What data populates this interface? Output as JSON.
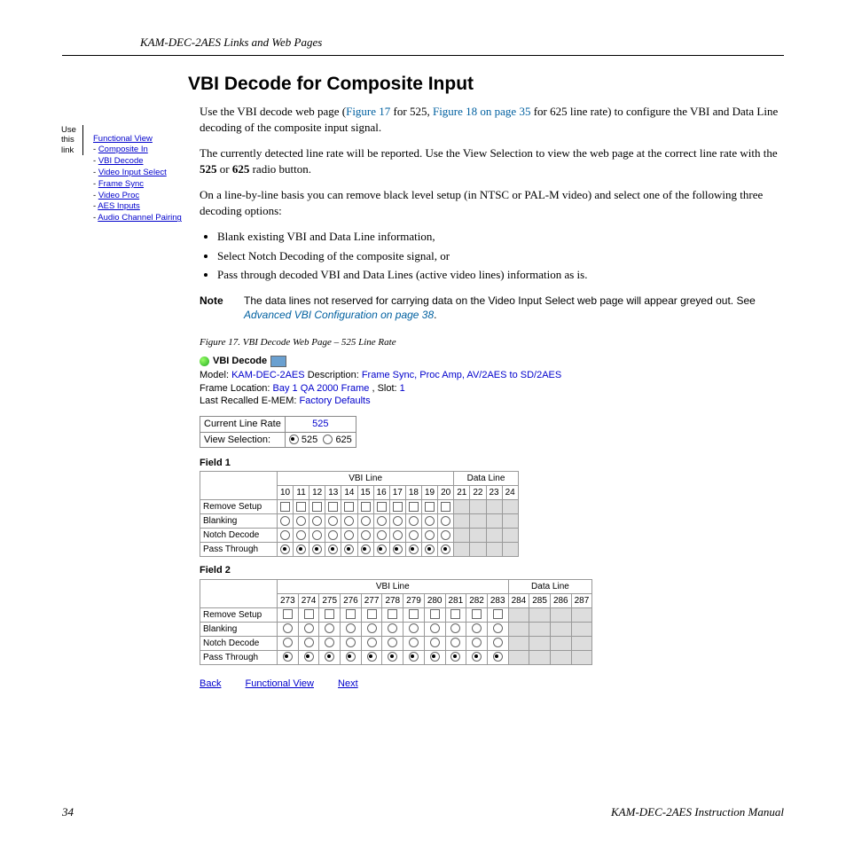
{
  "running_head": "KAM-DEC-2AES Links and Web Pages",
  "page_number": "34",
  "manual_name": "KAM-DEC-2AES Instruction Manual",
  "section_title": "VBI Decode for Composite Input",
  "sidebar": {
    "use_label": "Use this link",
    "links": [
      "Functional View",
      "Composite In",
      "VBI Decode",
      "Video Input Select",
      "Frame Sync",
      "Video Proc",
      "AES Inputs",
      "Audio Channel Pairing"
    ]
  },
  "body": {
    "p1a": "Use the VBI decode web page (",
    "p1_xref1": "Figure 17",
    "p1b": " for 525, ",
    "p1_xref2": "Figure 18 on page 35",
    "p1c": " for 625 line rate) to configure the VBI and Data Line decoding of the composite input signal.",
    "p2": "The currently detected line rate will be reported. Use the View Selection to view the web page at the correct line rate with the 525 or 625 radio button.",
    "p3": "On a line-by-line basis you can remove black level setup (in NTSC or PAL-M video) and select one of the following three decoding options:",
    "bullets": [
      "Blank existing VBI and Data Line information,",
      "Select Notch Decoding of the composite signal, or",
      "Pass through decoded VBI and Data Lines (active video lines) information as is."
    ],
    "note_label": "Note",
    "note_text_a": "The data lines not reserved for carrying data on the Video Input Select web page will appear greyed out. See ",
    "note_xref": "Advanced VBI Configuration",
    "note_text_b": " on page 38",
    "note_text_c": "."
  },
  "figure": {
    "caption": "Figure 17.  VBI Decode Web Page – 525 Line Rate",
    "panel_title": "VBI Decode",
    "model_label": "Model:",
    "model": "KAM-DEC-2AES",
    "desc_label": "Description:",
    "desc": "Frame Sync, Proc Amp, AV/2AES to SD/2AES",
    "frameloc_label": "Frame Location:",
    "frameloc": "Bay 1 QA 2000 Frame",
    "slot_label": ", Slot:",
    "slot": "1",
    "emem_label": "Last Recalled E-MEM:",
    "emem": "Factory Defaults",
    "clr_label": "Current Line Rate",
    "clr_value": "525",
    "vs_label": "View Selection:",
    "vs_525": "525",
    "vs_625": "625",
    "field1_label": "Field 1",
    "field2_label": "Field 2",
    "vbi_header": "VBI Line",
    "data_header": "Data Line",
    "f1_cols": [
      "10",
      "11",
      "12",
      "13",
      "14",
      "15",
      "16",
      "17",
      "18",
      "19",
      "20",
      "21",
      "22",
      "23",
      "24"
    ],
    "f2_cols": [
      "273",
      "274",
      "275",
      "276",
      "277",
      "278",
      "279",
      "280",
      "281",
      "282",
      "283",
      "284",
      "285",
      "286",
      "287"
    ],
    "rows": [
      "Remove Setup",
      "Blanking",
      "Notch Decode",
      "Pass Through"
    ],
    "nav": [
      "Back",
      "Functional View",
      "Next"
    ]
  }
}
